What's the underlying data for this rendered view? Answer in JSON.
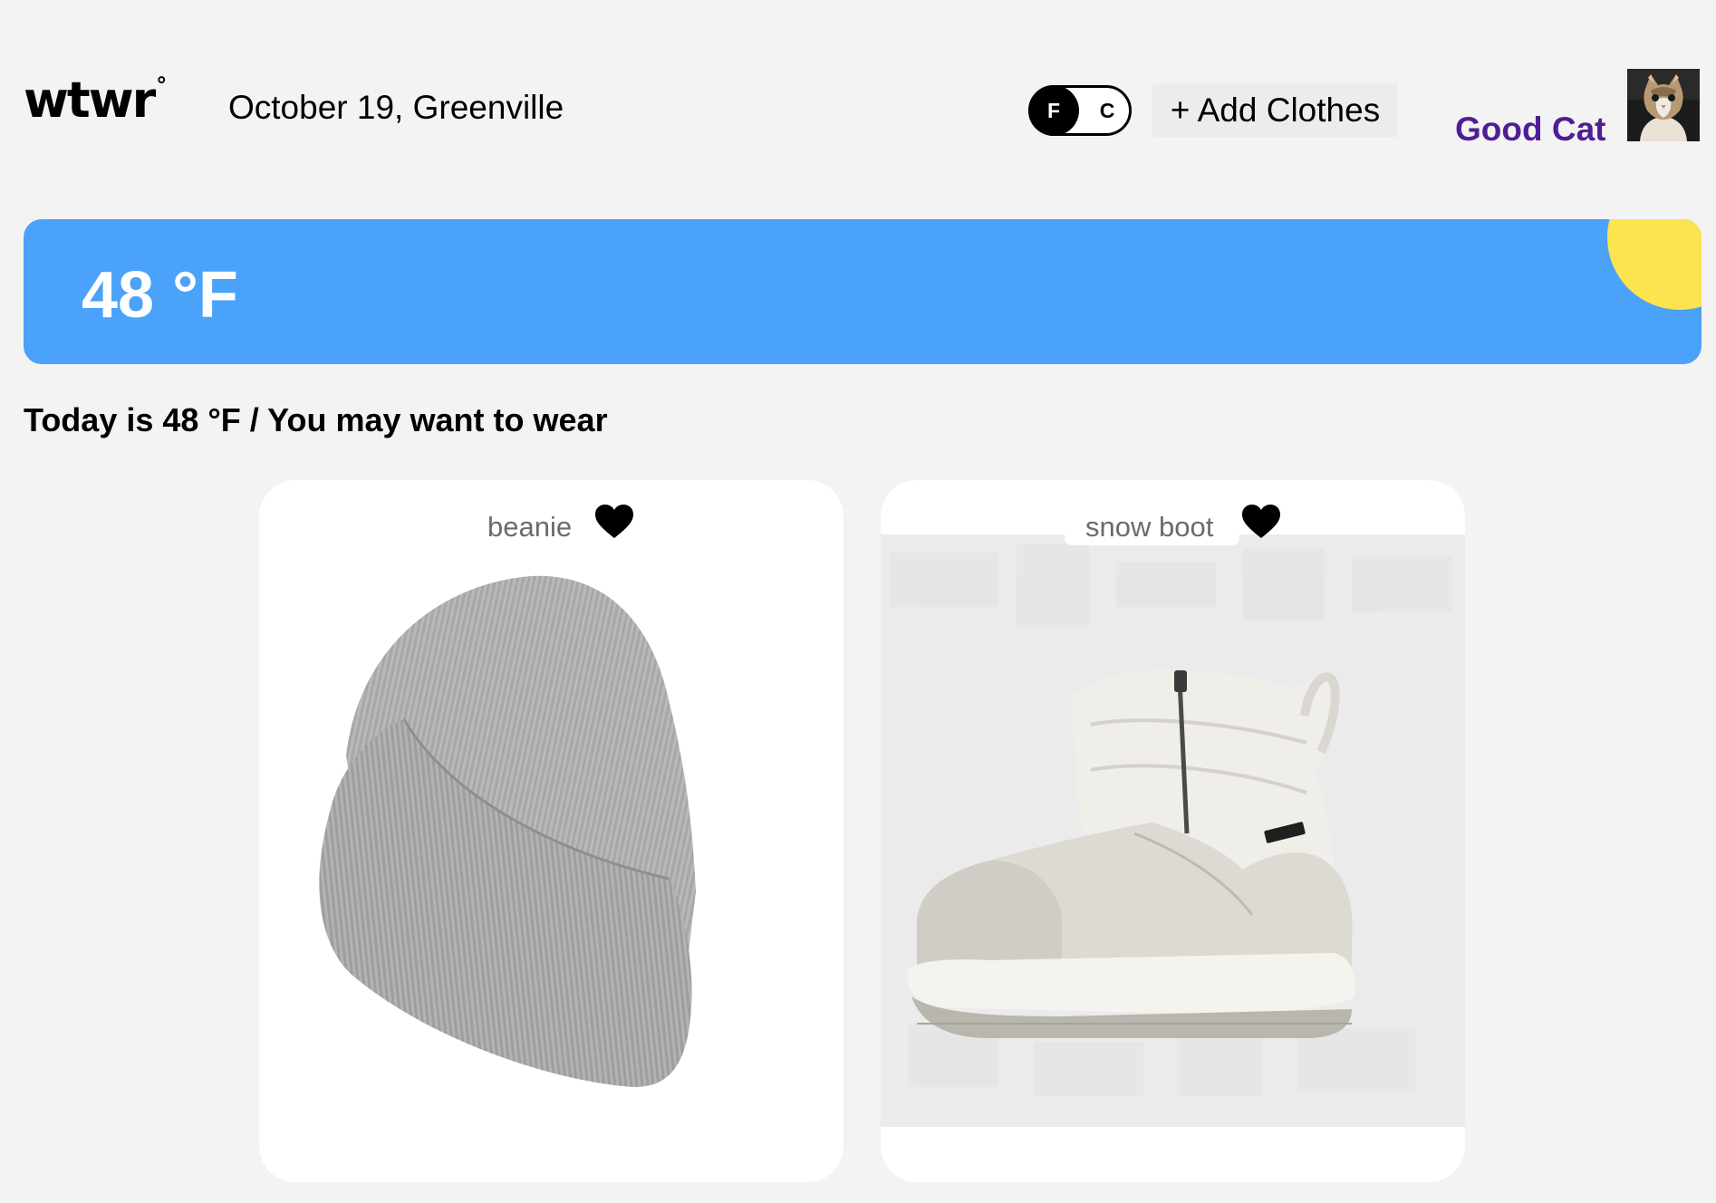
{
  "header": {
    "logo": "wtwr",
    "logo_mark": "°",
    "date_location": "October 19, Greenville",
    "unit_toggle": {
      "option_f": "F",
      "option_c": "C",
      "selected": "F"
    },
    "add_clothes_label": "+ Add Clothes",
    "username": "Good Cat",
    "avatar_icon": "cat-avatar"
  },
  "weather": {
    "temperature": "48 °F",
    "colors": {
      "banner": "#4aa2fa",
      "sun": "#fbe44d"
    }
  },
  "suggestion_text": "Today is 48 °F / You may want to wear",
  "items": [
    {
      "name": "beanie",
      "icon": "heart-icon",
      "image": "grey-beanie"
    },
    {
      "name": "snow boot",
      "icon": "heart-icon",
      "image": "white-snow-boot"
    }
  ],
  "colors": {
    "accent": "#4f1e96",
    "background": "#f3f3f3"
  }
}
